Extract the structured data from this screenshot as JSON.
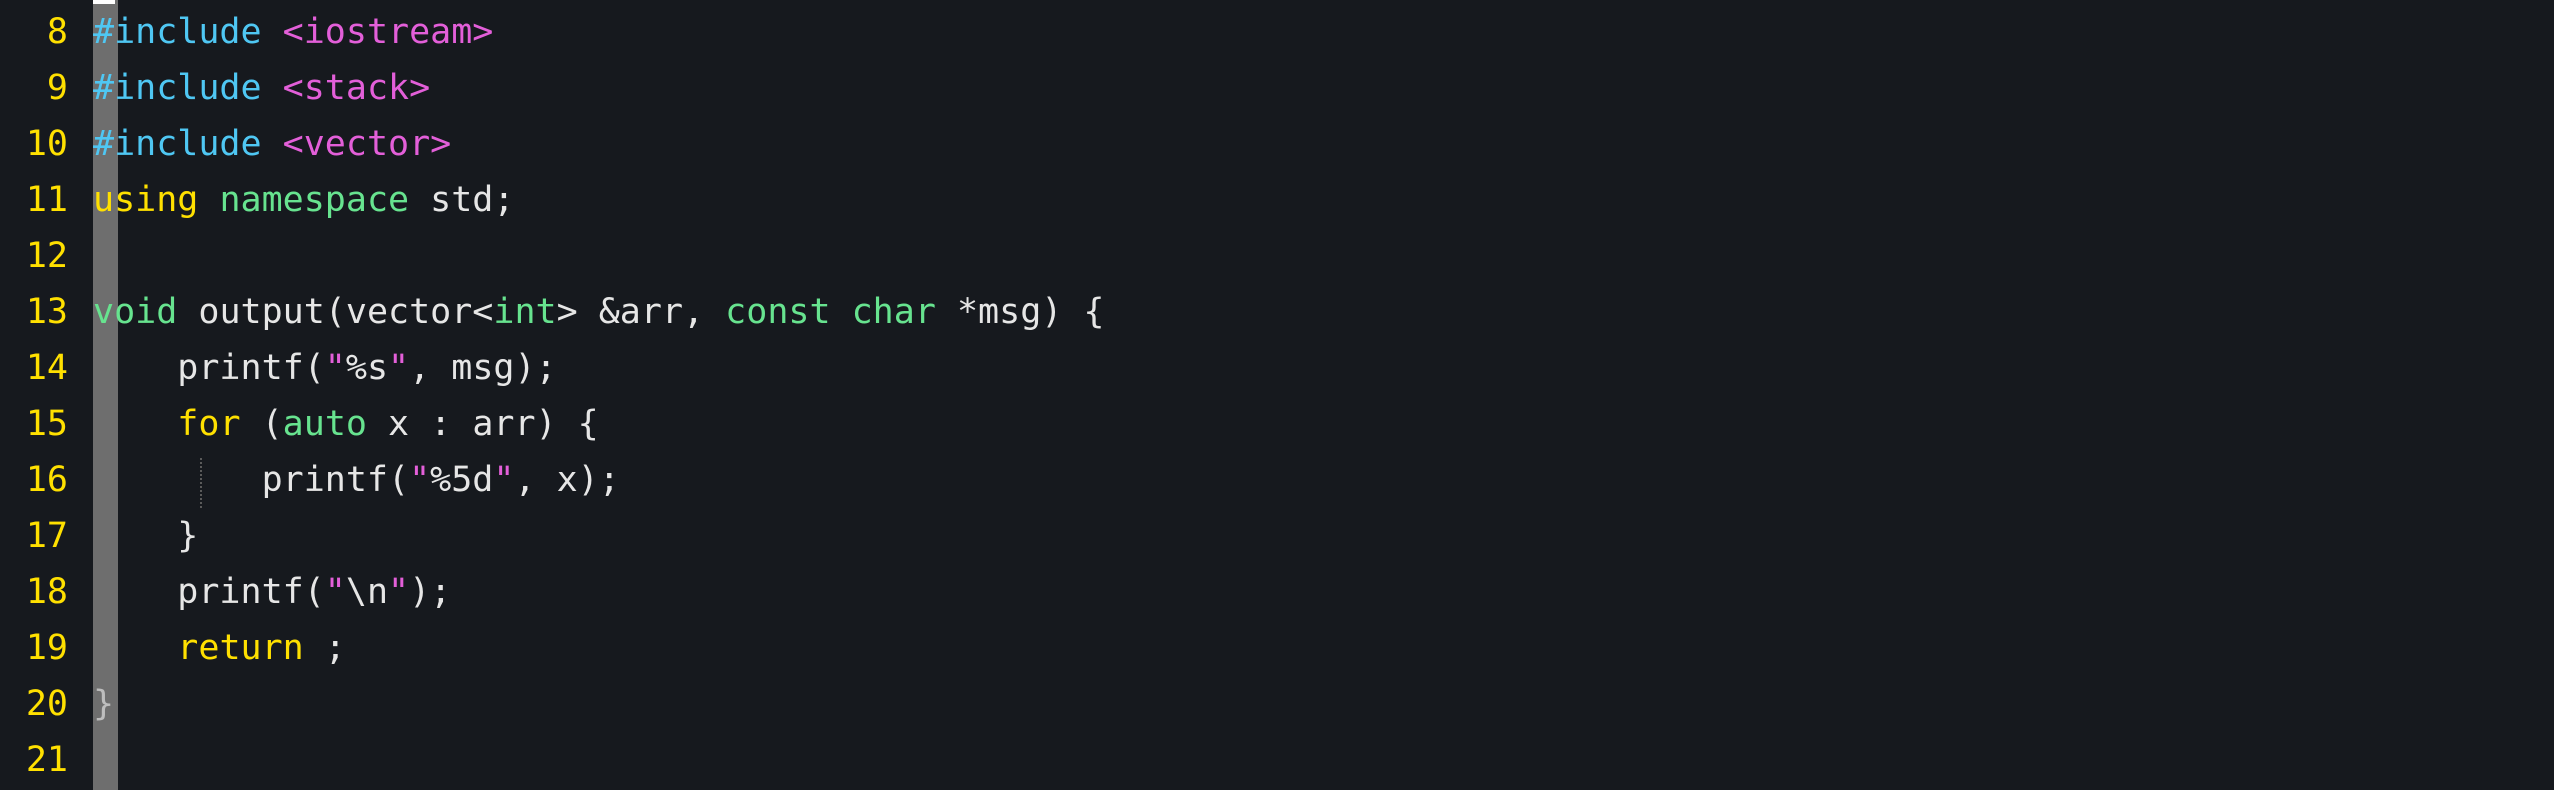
{
  "editor": {
    "language": "cpp",
    "colors": {
      "background": "#16191e",
      "line_number": "#ffe000",
      "preprocessor": "#4fc7f3",
      "include_path": "#e35fd9",
      "keyword": "#ffe000",
      "type": "#67e38f",
      "string": "#e35fd9",
      "text": "#e6e6e6",
      "gutter_bar": "#6e6e6e"
    },
    "lines": [
      {
        "number": "8",
        "tokens": [
          {
            "t": "#include",
            "c": "c-pre"
          },
          {
            "t": " ",
            "c": "c-txt"
          },
          {
            "t": "<iostream>",
            "c": "c-inc"
          }
        ]
      },
      {
        "number": "9",
        "tokens": [
          {
            "t": "#include",
            "c": "c-pre"
          },
          {
            "t": " ",
            "c": "c-txt"
          },
          {
            "t": "<stack>",
            "c": "c-inc"
          }
        ]
      },
      {
        "number": "10",
        "tokens": [
          {
            "t": "#include",
            "c": "c-pre"
          },
          {
            "t": " ",
            "c": "c-txt"
          },
          {
            "t": "<vector>",
            "c": "c-inc"
          }
        ]
      },
      {
        "number": "11",
        "tokens": [
          {
            "t": "using",
            "c": "c-kw"
          },
          {
            "t": " ",
            "c": "c-txt"
          },
          {
            "t": "namespace",
            "c": "c-ty"
          },
          {
            "t": " std;",
            "c": "c-txt"
          }
        ]
      },
      {
        "number": "12",
        "tokens": []
      },
      {
        "number": "13",
        "tokens": [
          {
            "t": "void",
            "c": "c-ty"
          },
          {
            "t": " output(vector<",
            "c": "c-txt"
          },
          {
            "t": "int",
            "c": "c-ty"
          },
          {
            "t": "> &arr, ",
            "c": "c-txt"
          },
          {
            "t": "const",
            "c": "c-ty"
          },
          {
            "t": " ",
            "c": "c-txt"
          },
          {
            "t": "char",
            "c": "c-ty"
          },
          {
            "t": " *msg) {",
            "c": "c-txt"
          }
        ]
      },
      {
        "number": "14",
        "tokens": [
          {
            "t": "    printf(",
            "c": "c-txt"
          },
          {
            "t": "\"",
            "c": "c-str"
          },
          {
            "t": "%s",
            "c": "c-txt"
          },
          {
            "t": "\"",
            "c": "c-str"
          },
          {
            "t": ", msg);",
            "c": "c-txt"
          }
        ]
      },
      {
        "number": "15",
        "tokens": [
          {
            "t": "    ",
            "c": "c-txt"
          },
          {
            "t": "for",
            "c": "c-kw"
          },
          {
            "t": " (",
            "c": "c-txt"
          },
          {
            "t": "auto",
            "c": "c-ty"
          },
          {
            "t": " x : arr) {",
            "c": "c-txt"
          }
        ]
      },
      {
        "number": "16",
        "tokens": [
          {
            "t": "        printf(",
            "c": "c-txt"
          },
          {
            "t": "\"",
            "c": "c-str"
          },
          {
            "t": "%5d",
            "c": "c-txt"
          },
          {
            "t": "\"",
            "c": "c-str"
          },
          {
            "t": ", x);",
            "c": "c-txt"
          }
        ]
      },
      {
        "number": "17",
        "tokens": [
          {
            "t": "    }",
            "c": "c-txt"
          }
        ]
      },
      {
        "number": "18",
        "tokens": [
          {
            "t": "    printf(",
            "c": "c-txt"
          },
          {
            "t": "\"",
            "c": "c-str"
          },
          {
            "t": "\\n",
            "c": "c-txt"
          },
          {
            "t": "\"",
            "c": "c-str"
          },
          {
            "t": ");",
            "c": "c-txt"
          }
        ]
      },
      {
        "number": "19",
        "tokens": [
          {
            "t": "    ",
            "c": "c-txt"
          },
          {
            "t": "return",
            "c": "c-kw"
          },
          {
            "t": " ;",
            "c": "c-txt"
          }
        ]
      },
      {
        "number": "20",
        "tokens": [
          {
            "t": "}",
            "c": "c-br"
          }
        ]
      },
      {
        "number": "21",
        "tokens": []
      }
    ]
  }
}
